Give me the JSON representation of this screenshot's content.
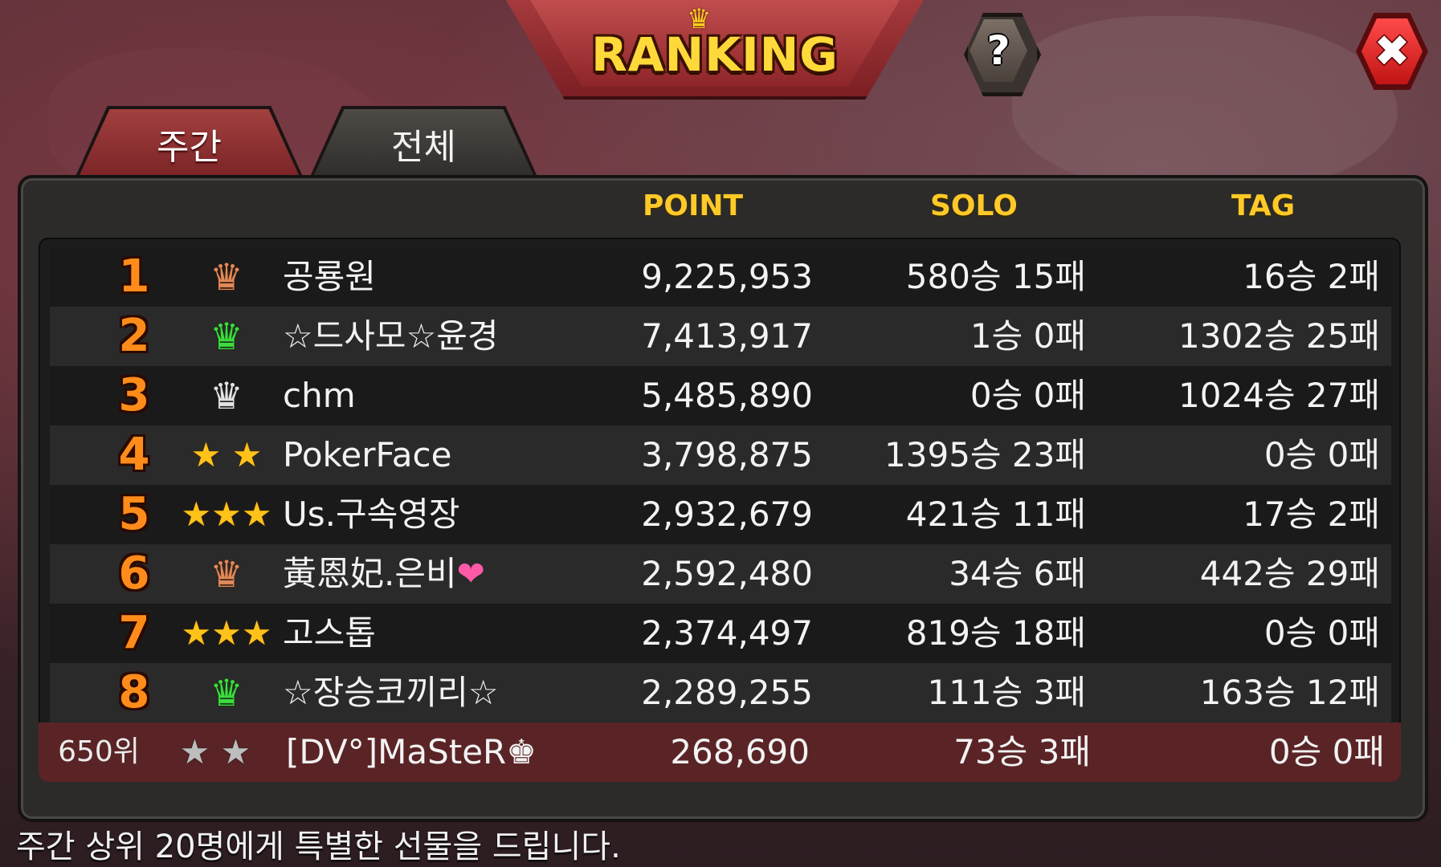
{
  "header": {
    "title": "RANKING",
    "help_label": "?",
    "close_label": "✖"
  },
  "tabs": [
    {
      "label": "주간",
      "active": true
    },
    {
      "label": "전체",
      "active": false
    }
  ],
  "columns": {
    "point": "POINT",
    "solo": "SOLO",
    "tag": "TAG"
  },
  "rows": [
    {
      "rank": "1",
      "grade": "crown-bronze",
      "name": "공룡원",
      "point": "9,225,953",
      "solo": "580승 15패",
      "tag": "16승 2패"
    },
    {
      "rank": "2",
      "grade": "crown-green",
      "name": "☆드사모☆윤경",
      "point": "7,413,917",
      "solo": "1승 0패",
      "tag": "1302승 25패"
    },
    {
      "rank": "3",
      "grade": "crown-silver",
      "name": "chm",
      "point": "5,485,890",
      "solo": "0승 0패",
      "tag": "1024승 27패"
    },
    {
      "rank": "4",
      "grade": "stars-2",
      "name": "PokerFace",
      "point": "3,798,875",
      "solo": "1395승 23패",
      "tag": "0승 0패"
    },
    {
      "rank": "5",
      "grade": "stars-3",
      "name": "Us.구속영장",
      "point": "2,932,679",
      "solo": "421승 11패",
      "tag": "17승 2패"
    },
    {
      "rank": "6",
      "grade": "crown-bronze",
      "name": "黃恩妃.은비",
      "name_suffix": "❤",
      "point": "2,592,480",
      "solo": "34승 6패",
      "tag": "442승 29패"
    },
    {
      "rank": "7",
      "grade": "stars-3",
      "name": "고스톱",
      "point": "2,374,497",
      "solo": "819승 18패",
      "tag": "0승 0패"
    },
    {
      "rank": "8",
      "grade": "crown-green",
      "name": "☆장승코끼리☆",
      "point": "2,289,255",
      "solo": "111승 3패",
      "tag": "163승 12패"
    }
  ],
  "my_row": {
    "rank": "650위",
    "grade": "stars-2-gray",
    "name": "[DV°]MaSteR♚",
    "point": "268,690",
    "solo": "73승 3패",
    "tag": "0승 0패"
  },
  "footer": {
    "message": "주간 상위 20명에게 특별한 선물을 드립니다."
  },
  "colors": {
    "accent": "#ffc928",
    "rank": "#ff8c1a",
    "my_row_bg": "#5a2426",
    "tab_active": "#a2403f"
  }
}
